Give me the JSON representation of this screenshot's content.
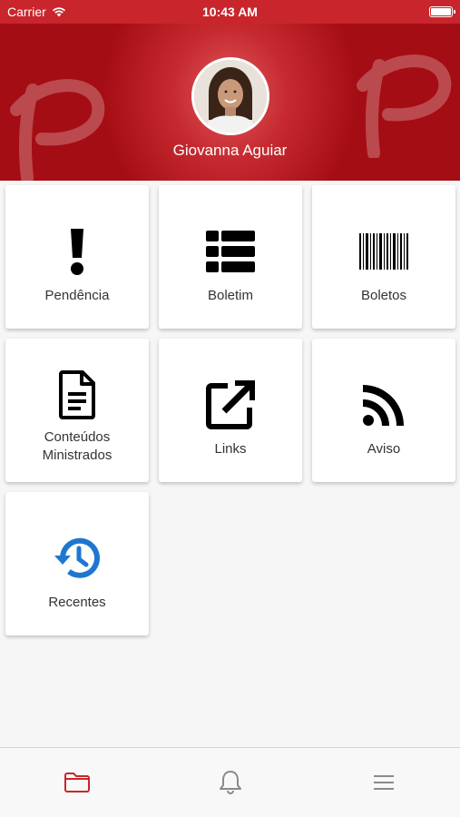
{
  "status_bar": {
    "carrier": "Carrier",
    "time": "10:43 AM"
  },
  "profile": {
    "name": "Giovanna Aguiar"
  },
  "menu": {
    "items": [
      {
        "label": "Pendência",
        "icon": "exclamation-icon"
      },
      {
        "label": "Boletim",
        "icon": "list-icon"
      },
      {
        "label": "Boletos",
        "icon": "barcode-icon"
      },
      {
        "label": "Conteúdos\nMinistrados",
        "icon": "document-icon"
      },
      {
        "label": "Links",
        "icon": "external-link-icon"
      },
      {
        "label": "Aviso",
        "icon": "rss-icon"
      },
      {
        "label": "Recentes",
        "icon": "history-icon"
      }
    ]
  },
  "tab_bar": {
    "tabs": [
      "folder-icon",
      "bell-icon",
      "menu-icon"
    ],
    "active_index": 0
  },
  "colors": {
    "brand": "#c8262c",
    "active_tab": "#c8262c",
    "history_icon": "#1f76d2"
  }
}
